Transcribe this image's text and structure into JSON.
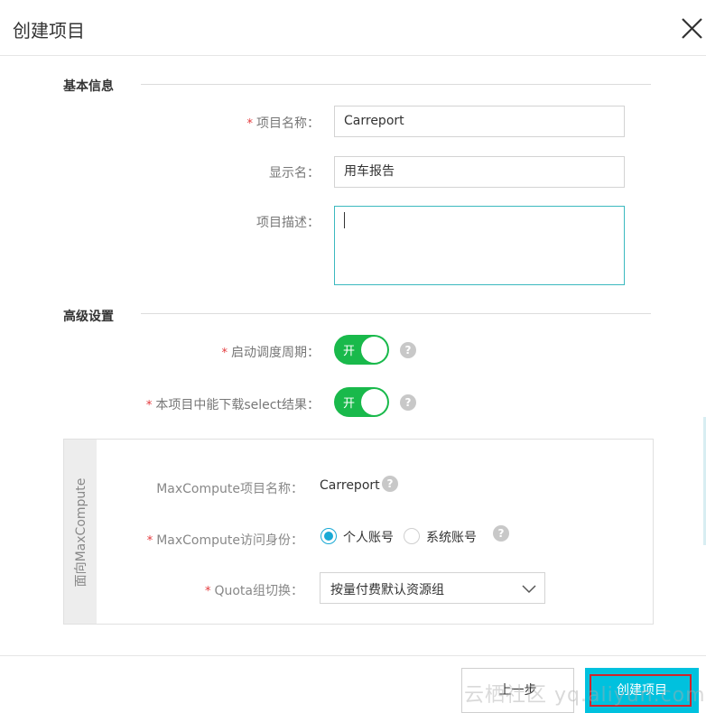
{
  "dialog": {
    "title": "创建项目"
  },
  "basic": {
    "section_title": "基本信息",
    "project_name_label": "项目名称：",
    "project_name_value": "Carreport",
    "display_name_label": "显示名：",
    "display_name_value": "用车报告",
    "description_label": "项目描述：",
    "description_value": ""
  },
  "advanced": {
    "section_title": "高级设置",
    "schedule_label": "启动调度周期：",
    "schedule_switch_text": "开",
    "schedule_on": true,
    "download_label": "本项目中能下载select结果：",
    "download_switch_text": "开",
    "download_on": true
  },
  "maxcompute": {
    "side_title": "面向MaxCompute",
    "name_label": "MaxCompute项目名称：",
    "name_value": "Carreport",
    "identity_label": "MaxCompute访问身份：",
    "identity_options": [
      "个人账号",
      "系统账号"
    ],
    "identity_selected": "个人账号",
    "quota_label": "Quota组切换：",
    "quota_value": "按量付费默认资源组"
  },
  "footer": {
    "prev_label": "上一步",
    "create_label": "创建项目"
  },
  "watermark": "云栖社区 yq.aliyun.com",
  "icons": {
    "close": "close-icon",
    "help": "?",
    "select_arrow": "chevron-down-icon"
  },
  "colors": {
    "required": "#e4393c",
    "switch_on": "#19b94b",
    "primary": "#00c1de",
    "focus_border": "#3cb9bf",
    "radio_checked": "#19a9d5"
  }
}
